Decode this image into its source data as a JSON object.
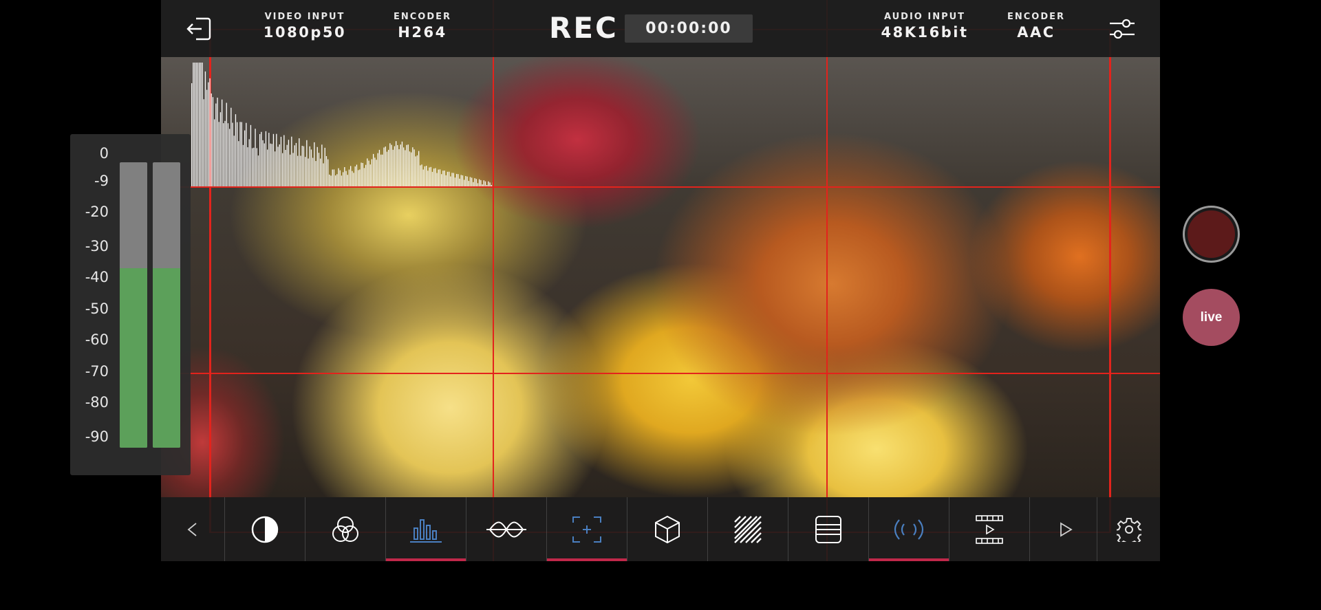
{
  "header": {
    "video_input_label": "VIDEO INPUT",
    "video_input_value": "1080p50",
    "video_encoder_label": "ENCODER",
    "video_encoder_value": "H264",
    "rec_label": "REC",
    "timecode": "00:00:00",
    "audio_input_label": "AUDIO INPUT",
    "audio_input_value": "48K16bit",
    "audio_encoder_label": "ENCODER",
    "audio_encoder_value": "AAC"
  },
  "audio_meter": {
    "scale": [
      "0",
      "-9",
      "-20",
      "-30",
      "-40",
      "-50",
      "-60",
      "-70",
      "-80",
      "-90"
    ],
    "channels": [
      {
        "level_db": -40
      },
      {
        "level_db": -40
      }
    ]
  },
  "right_controls": {
    "live_label": "live"
  },
  "toolbar": {
    "items": [
      {
        "icon": "chevron-left-icon",
        "active": false
      },
      {
        "icon": "exposure-icon",
        "active": false
      },
      {
        "icon": "color-channels-icon",
        "active": false
      },
      {
        "icon": "histogram-icon",
        "active": true
      },
      {
        "icon": "waveform-icon",
        "active": false
      },
      {
        "icon": "focus-frame-icon",
        "active": true
      },
      {
        "icon": "lut-cube-icon",
        "active": false
      },
      {
        "icon": "zebra-icon",
        "active": false
      },
      {
        "icon": "guides-icon",
        "active": false
      },
      {
        "icon": "stream-signal-icon",
        "active": true
      },
      {
        "icon": "filmstrip-play-icon",
        "active": false
      },
      {
        "icon": "chevron-right-icon",
        "active": false
      },
      {
        "icon": "gear-icon",
        "active": false
      }
    ]
  },
  "colors": {
    "accent": "#c0284a",
    "grid": "#e3231c",
    "meter_green": "#5ca05a",
    "live": "#a44c60",
    "active_icon": "#4a7fc0"
  }
}
